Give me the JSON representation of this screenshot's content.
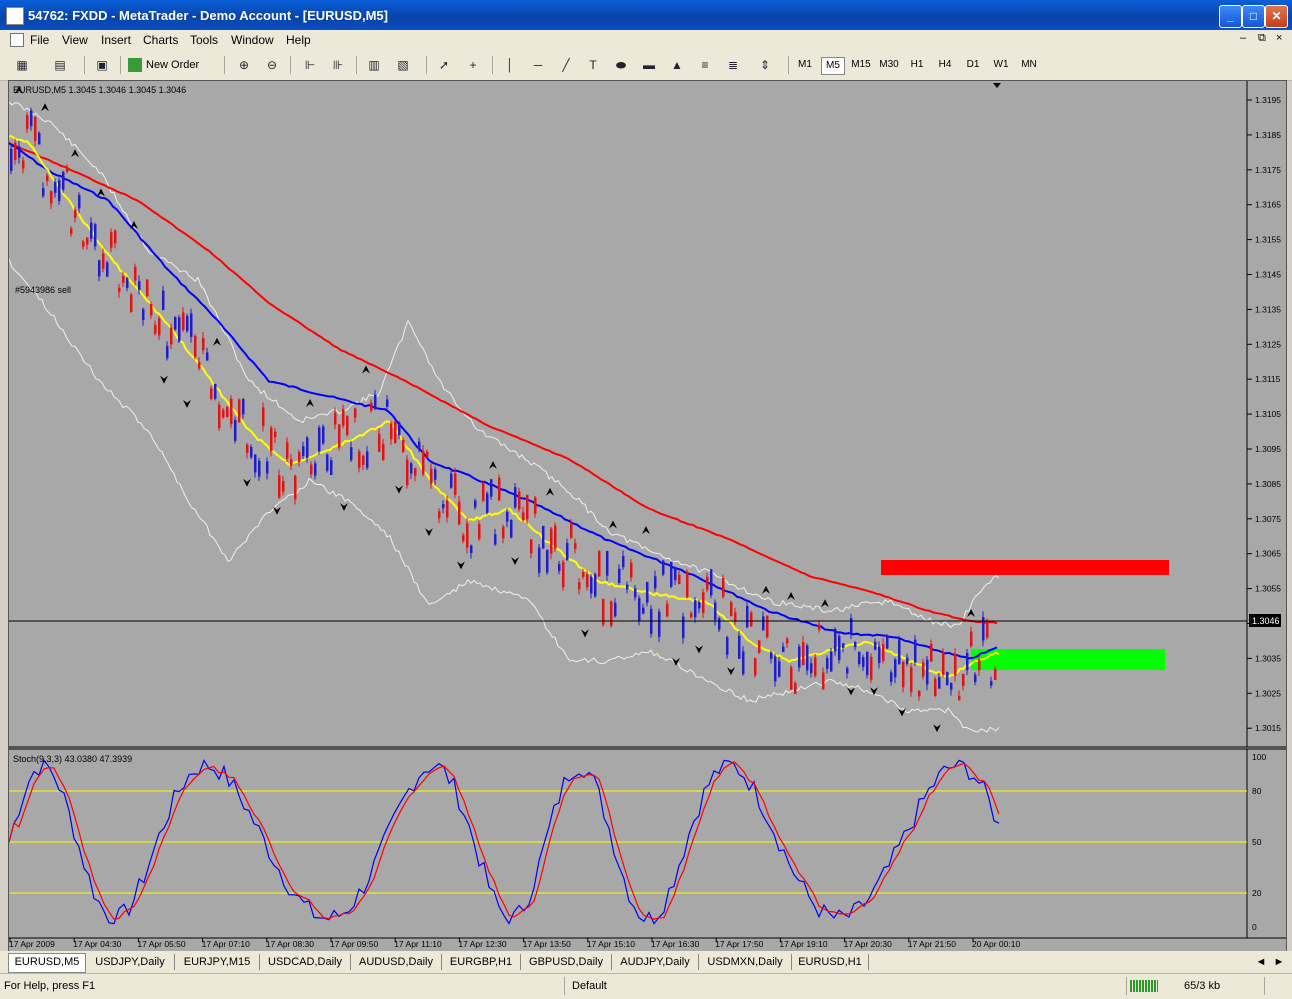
{
  "window": {
    "title": "54762: FXDD - MetaTrader - Demo Account - [EURUSD,M5]",
    "btn_minimize": "_",
    "btn_maximize": "□",
    "btn_close": "✕"
  },
  "menu": {
    "items": [
      "File",
      "View",
      "Insert",
      "Charts",
      "Tools",
      "Window",
      "Help"
    ],
    "mdi_minimize": "–",
    "mdi_restore": "⧉",
    "mdi_close": "×"
  },
  "toolbar": {
    "new_order_label": "New Order",
    "timeframes": [
      "M1",
      "M5",
      "M15",
      "M30",
      "H1",
      "H4",
      "D1",
      "W1",
      "MN"
    ],
    "active_timeframe": "M5"
  },
  "chart": {
    "header": "EURUSD,M5  1.3045 1.3046 1.3045 1.3046",
    "order_label": "#5943986 sell",
    "current_price_label": "1.3046",
    "price_ticks": [
      "1.3195",
      "1.3185",
      "1.3175",
      "1.3165",
      "1.3155",
      "1.3145",
      "1.3135",
      "1.3125",
      "1.3115",
      "1.3105",
      "1.3095",
      "1.3085",
      "1.3075",
      "1.3065",
      "1.3055",
      "1.3045",
      "1.3035",
      "1.3025",
      "1.3015"
    ],
    "time_ticks": [
      "17 Apr 2009",
      "17 Apr 04:30",
      "17 Apr 05:50",
      "17 Apr 07:10",
      "17 Apr 08:30",
      "17 Apr 09:50",
      "17 Apr 11:10",
      "17 Apr 12:30",
      "17 Apr 13:50",
      "17 Apr 15:10",
      "17 Apr 16:30",
      "17 Apr 17:50",
      "17 Apr 19:10",
      "17 Apr 20:30",
      "17 Apr 21:50",
      "20 Apr 00:10"
    ]
  },
  "stochastic": {
    "header": "Stoch(9,3,3) 43.0380 47.3939",
    "levels": [
      "100",
      "80",
      "50",
      "20",
      "0"
    ]
  },
  "tabs": [
    "EURUSD,M5",
    "USDJPY,Daily",
    "EURJPY,M15",
    "USDCAD,Daily",
    "AUDUSD,Daily",
    "EURGBP,H1",
    "GBPUSD,Daily",
    "AUDJPY,Daily",
    "USDMXN,Daily",
    "EURUSD,H1"
  ],
  "tab_nav_left": "◄",
  "tab_nav_right": "►",
  "status": {
    "help": "For Help, press F1",
    "profile": "Default",
    "traffic": "65/3 kb"
  },
  "colors": {
    "chart_bg": "#a8a8a8",
    "bull_candle": "#1e1ec8",
    "bear_candle": "#e01414",
    "ma_fast": "#ffff00",
    "ma_mid": "#0000ff",
    "ma_slow": "#ff0000",
    "bands": "#f0f0f0",
    "resistance_zone": "#ff0000",
    "support_zone": "#00ff00"
  }
}
